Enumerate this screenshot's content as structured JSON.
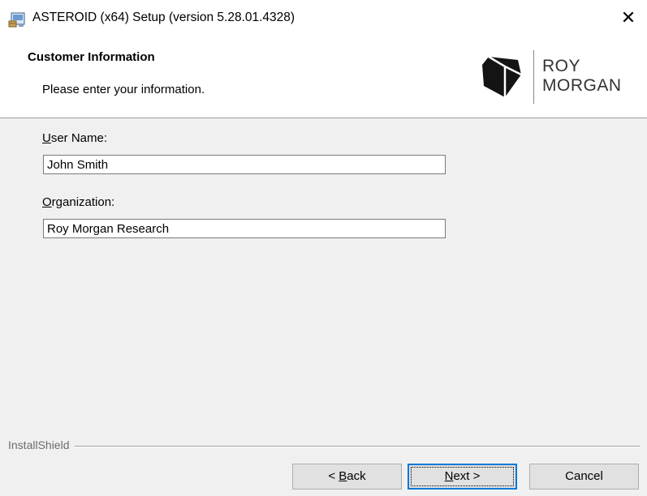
{
  "window": {
    "title": "ASTEROID (x64) Setup (version 5.28.01.4328)",
    "close_glyph": "✕"
  },
  "header": {
    "title": "Customer Information",
    "subtitle": "Please enter your information."
  },
  "logo": {
    "line1": "ROY",
    "line2": "MORGAN"
  },
  "fields": {
    "user_name": {
      "accel": "U",
      "label_rest": "ser Name:",
      "value": "John Smith"
    },
    "organization": {
      "accel": "O",
      "label_rest": "rganization:",
      "value": "Roy Morgan Research"
    }
  },
  "footer": {
    "brand": "InstallShield"
  },
  "buttons": {
    "back": {
      "prefix": "< ",
      "accel": "B",
      "rest": "ack"
    },
    "next": {
      "accel": "N",
      "rest": "ext >"
    },
    "cancel": {
      "label": "Cancel"
    }
  },
  "icons": {
    "app": "installer-icon",
    "close": "close-icon",
    "logo": "roy-morgan-logo-icon"
  },
  "colors": {
    "header_bg": "#ffffff",
    "body_bg": "#f0f0f0",
    "focus_border": "#0078d7",
    "button_bg": "#e1e1e1"
  }
}
